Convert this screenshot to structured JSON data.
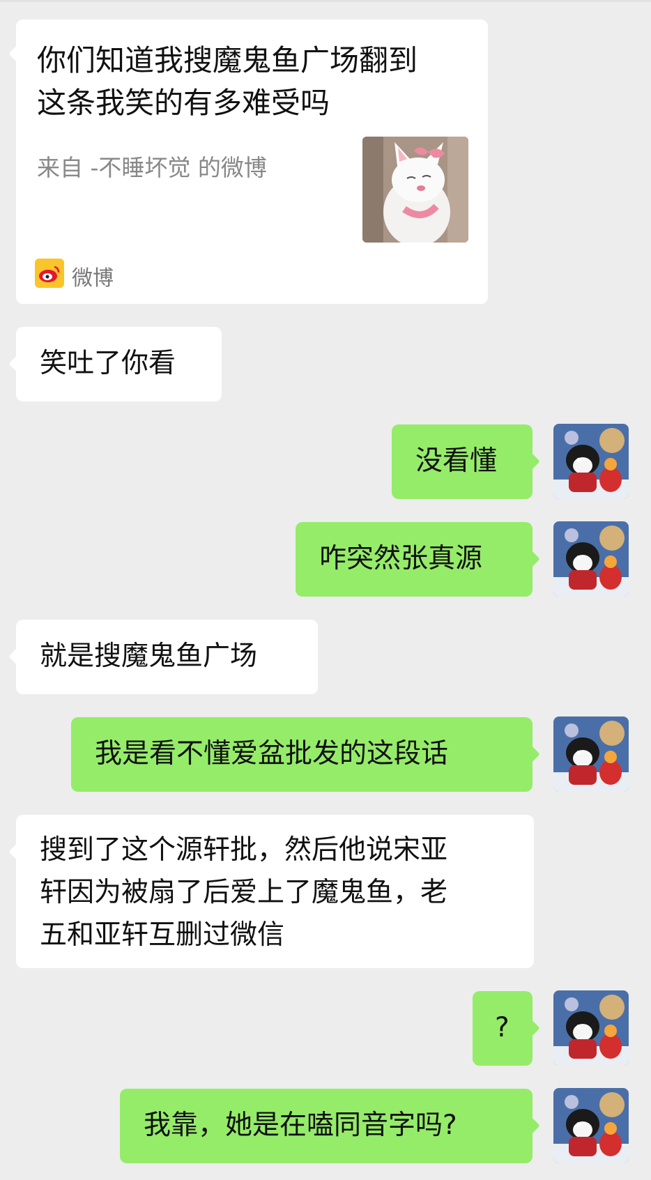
{
  "share_card": {
    "title_lines": [
      "你们知道我搜魔鬼鱼广场翻到",
      "这条我笑的有多难受吗"
    ],
    "source": "来自 -不睡坏觉 的微博",
    "thumbnail_icon": "cartoon-cat-thumbnail",
    "app_icon": "weibo-icon",
    "app_name": "微博"
  },
  "messages": [
    {
      "side": "left",
      "lines": [
        "笑吐了你看"
      ]
    },
    {
      "side": "right",
      "lines": [
        "没看懂"
      ]
    },
    {
      "side": "right",
      "lines": [
        "咋突然张真源"
      ]
    },
    {
      "side": "left",
      "lines": [
        "就是搜魔鬼鱼广场"
      ]
    },
    {
      "side": "right",
      "lines": [
        "我是看不懂爱盆批发的这段话"
      ]
    },
    {
      "side": "left",
      "lines": [
        "搜到了这个源轩批，然后他说宋亚",
        "轩因为被扇了后爱上了魔鬼鱼，老",
        "五和亚轩互删过微信"
      ]
    },
    {
      "side": "right",
      "lines": [
        "?"
      ]
    },
    {
      "side": "right",
      "lines": [
        "我靠，她是在嗑同音字吗?"
      ]
    }
  ],
  "colors": {
    "background": "#ededed",
    "incoming_bubble": "#ffffff",
    "outgoing_bubble": "#95ec69"
  }
}
